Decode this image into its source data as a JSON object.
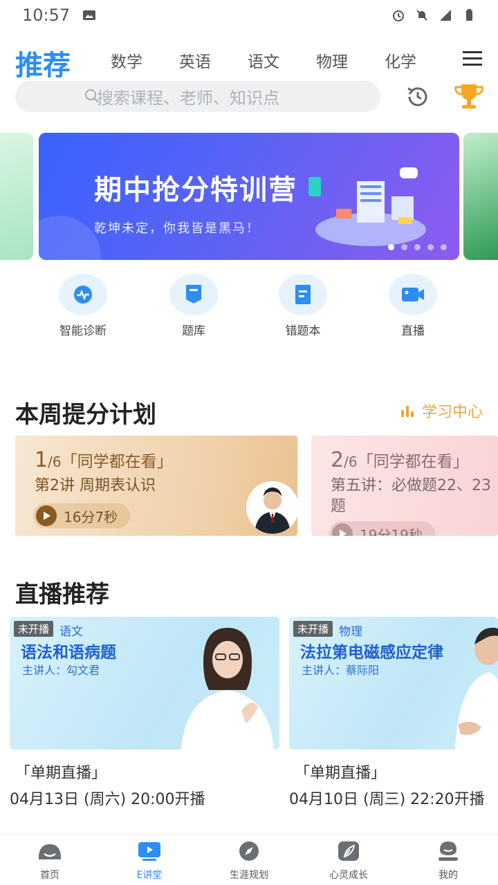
{
  "status_bar": {
    "time": "10:57"
  },
  "top_tabs": {
    "active": "推荐",
    "tabs": [
      "数学",
      "英语",
      "语文",
      "物理",
      "化学"
    ]
  },
  "search": {
    "placeholder": "搜索课程、老师、知识点"
  },
  "banner": {
    "title": "期中抢分特训营",
    "subtitle": "乾坤未定，你我皆是黑马！",
    "page_count": 5,
    "active_index": 0
  },
  "quick_entries": [
    {
      "label": "智能诊断",
      "icon": "diagnosis-icon"
    },
    {
      "label": "题库",
      "icon": "question-bank-icon"
    },
    {
      "label": "错题本",
      "icon": "mistake-book-icon"
    },
    {
      "label": "直播",
      "icon": "live-camera-icon"
    }
  ],
  "weekly_plan": {
    "title": "本周提分计划",
    "link": "学习中心",
    "cards": [
      {
        "index": "1",
        "total": "/6",
        "tag": "「同学都在看」",
        "lesson": "第2讲 周期表认识",
        "duration": "16分7秒"
      },
      {
        "index": "2",
        "total": "/6",
        "tag": "「同学都在看」",
        "lesson": "第五讲：必做题22、23题",
        "duration": "19分19秒"
      }
    ]
  },
  "live_section": {
    "title": "直播推荐",
    "cards": [
      {
        "badge": "未开播",
        "subject": "语文",
        "title": "语法和语病题",
        "teacher": "主讲人：勾文君",
        "type": "「单期直播」",
        "time": "04月13日 (周六) 20:00开播"
      },
      {
        "badge": "未开播",
        "subject": "物理",
        "title": "法拉第电磁感应定律",
        "teacher": "主讲人：蔡际阳",
        "type": "「单期直播」",
        "time": "04月10日 (周三) 22:20开播"
      }
    ]
  },
  "bottom_nav": {
    "items": [
      {
        "label": "首页",
        "icon": "home-icon"
      },
      {
        "label": "E讲堂",
        "icon": "video-lecture-icon"
      },
      {
        "label": "生涯规划",
        "icon": "compass-icon"
      },
      {
        "label": "心灵成长",
        "icon": "leaf-icon"
      },
      {
        "label": "我的",
        "icon": "profile-icon"
      }
    ],
    "active_index": 1
  },
  "colors": {
    "accent": "#2c8df5",
    "orange": "#f5a13b"
  }
}
